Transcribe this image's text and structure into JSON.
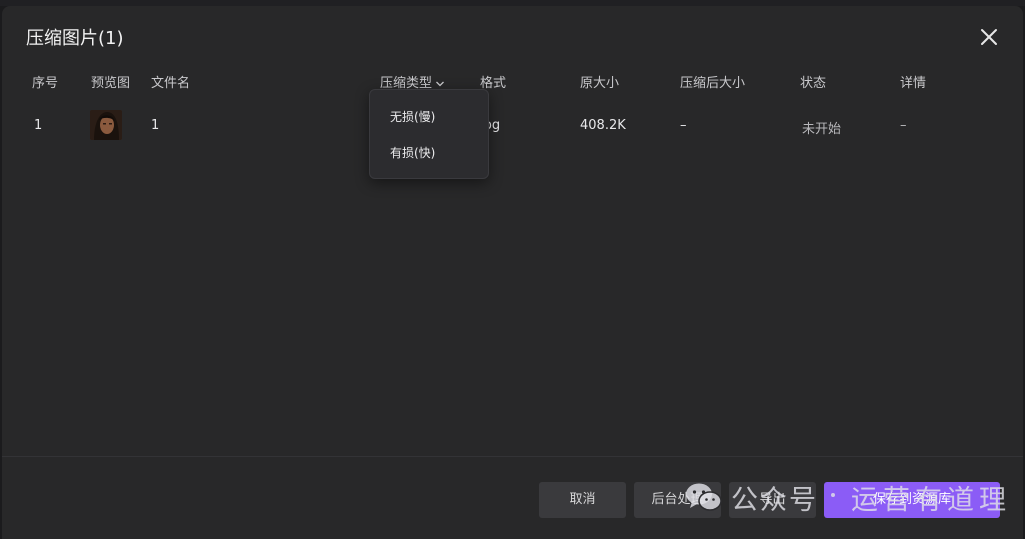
{
  "dialog": {
    "title": "压缩图片(1)"
  },
  "table": {
    "columns": {
      "index": "序号",
      "preview": "预览图",
      "filename": "文件名",
      "compress_type": "压缩类型",
      "format": "格式",
      "original_size": "原大小",
      "compressed_size": "压缩后大小",
      "status": "状态",
      "details": "详情"
    },
    "rows": [
      {
        "index": "1",
        "filename": "1",
        "format": "jpg",
        "original_size": "408.2K",
        "compressed_size": "–",
        "status": "未开始",
        "details": "–"
      }
    ]
  },
  "compress_type_dropdown": {
    "options": [
      "无损(慢)",
      "有损(快)"
    ]
  },
  "footer": {
    "cancel_label": "取消",
    "background_label": "后台处理",
    "export_label": "导出",
    "save_label": "保存到资源库"
  },
  "watermark": {
    "text1": "公众号",
    "text2": "运营有道理"
  },
  "colors": {
    "background": "#1b1b1d",
    "dialog": "#282829",
    "primary_button": "#8b5cf6",
    "secondary_button": "#3a3a3d"
  },
  "icons": [
    "close-icon",
    "chevron-down-icon",
    "wechat-icon"
  ]
}
